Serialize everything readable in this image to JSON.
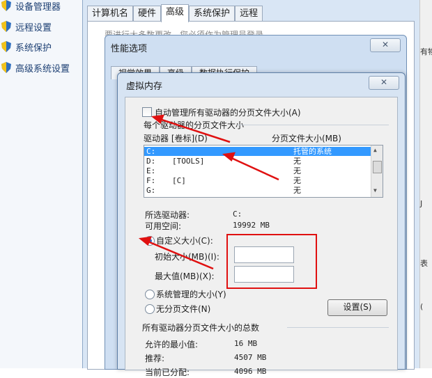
{
  "sidebar": {
    "items": [
      {
        "label": "设备管理器",
        "icon": "shield-icon"
      },
      {
        "label": "远程设置",
        "icon": "shield-icon"
      },
      {
        "label": "系统保护",
        "icon": "shield-icon"
      },
      {
        "label": "高级系统设置",
        "icon": "shield-icon"
      }
    ]
  },
  "system_properties": {
    "tabs": [
      "计算机名",
      "硬件",
      "高级",
      "系统保护",
      "远程"
    ],
    "active_tab": "高级",
    "partial_text": "要进行大多数更改，您必须作为管理员登录。"
  },
  "right_edge": {
    "glyph_1": "有物",
    "glyph_2": "J",
    "glyph_3": "表",
    "glyph_4": "("
  },
  "performance_options": {
    "title": "性能选项",
    "close_label": "✕",
    "tabs": [
      "视觉效果",
      "高级",
      "数据执行保护"
    ]
  },
  "virtual_memory": {
    "title": "虚拟内存",
    "close_label": "✕",
    "auto_manage_label": "自动管理所有驱动器的分页文件大小(A)",
    "auto_manage_checked": false,
    "per_drive_group": "每个驱动器的分页文件大小",
    "col_drive": "驱动器 [卷标](D)",
    "col_size": "分页文件大小(MB)",
    "drives": [
      {
        "drive": "C:",
        "label": "",
        "size": "托管的系统",
        "selected": true
      },
      {
        "drive": "D:",
        "label": "[TOOLS]",
        "size": "无",
        "selected": false
      },
      {
        "drive": "E:",
        "label": "",
        "size": "无",
        "selected": false
      },
      {
        "drive": "F:",
        "label": "[C]",
        "size": "无",
        "selected": false
      },
      {
        "drive": "G:",
        "label": "",
        "size": "无",
        "selected": false
      }
    ],
    "selected_drive_label": "所选驱动器:",
    "selected_drive_value": "C:",
    "free_space_label": "可用空间:",
    "free_space_value": "19992 MB",
    "custom_size_label": "自定义大小(C):",
    "initial_size_label": "初始大小(MB)(I):",
    "initial_size_value": "",
    "max_size_label": "最大值(MB)(X):",
    "max_size_value": "",
    "system_managed_label": "系统管理的大小(Y)",
    "no_paging_label": "无分页文件(N)",
    "set_button": "设置(S)",
    "total_group": "所有驱动器分页文件大小的总数",
    "min_allowed_label": "允许的最小值:",
    "min_allowed_value": "16 MB",
    "recommended_label": "推荐:",
    "recommended_value": "4507 MB",
    "current_label": "当前已分配:",
    "current_value": "4096 MB"
  },
  "annotation_color": "#e01010"
}
